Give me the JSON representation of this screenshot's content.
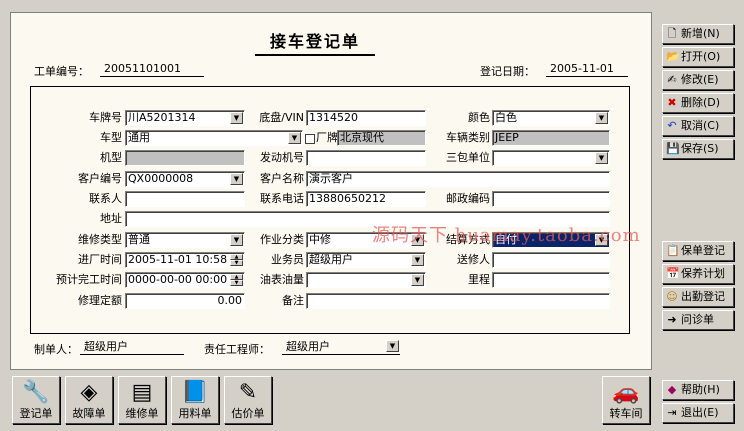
{
  "title": "接车登记单",
  "header": {
    "work_order_label": "工单编号：",
    "work_order_value": "20051101001",
    "register_date_label": "登记日期：",
    "register_date_value": "2005-11-01"
  },
  "form": {
    "plate_label": "车牌号",
    "plate_value": "川A5201314",
    "vin_label": "底盘/VIN",
    "vin_value": "1314520",
    "color_label": "颜色",
    "color_value": "白色",
    "model_label": "车型",
    "model_value": "通用",
    "factory_label": "厂牌",
    "factory_value": "北京现代",
    "vehicle_type_label": "车辆类别",
    "vehicle_type_value": "JEEP",
    "engine_model_label": "机型",
    "engine_model_value": "",
    "engine_no_label": "发动机号",
    "engine_no_value": "",
    "warranty_label": "三包单位",
    "warranty_value": "",
    "customer_no_label": "客户编号",
    "customer_no_value": "QX0000008",
    "customer_name_label": "客户名称",
    "customer_name_value": "演示客户",
    "contact_label": "联系人",
    "contact_value": "",
    "phone_label": "联系电话",
    "phone_value": "13880650212",
    "postcode_label": "邮政编码",
    "postcode_value": "",
    "address_label": "地址",
    "address_value": "",
    "repair_type_label": "维修类型",
    "repair_type_value": "普通",
    "work_class_label": "作业分类",
    "work_class_value": "中修",
    "settle_label": "结算方式",
    "settle_value": "自付",
    "enter_time_label": "进厂时间",
    "enter_time_value": "2005-11-01 10:58",
    "salesman_label": "业务员",
    "salesman_value": "超级用户",
    "sender_label": "送修人",
    "sender_value": "",
    "finish_time_label": "预计完工时间",
    "finish_time_value": "0000-00-00 00:00",
    "fuel_label": "油表油量",
    "fuel_value": "",
    "mileage_label": "里程",
    "mileage_value": "",
    "quota_label": "修理定额",
    "quota_value": "0.00",
    "note_label": "备注",
    "note_value": ""
  },
  "footer": {
    "creator_label": "制单人：",
    "creator_value": "超级用户",
    "engineer_label": "责任工程师：",
    "engineer_value": "超级用户"
  },
  "right_buttons": [
    {
      "label": "新增(N)",
      "icon": "new-doc-icon",
      "glyph": "🗋"
    },
    {
      "label": "打开(O)",
      "icon": "open-folder-icon",
      "glyph": "📂"
    },
    {
      "label": "修改(E)",
      "icon": "edit-icon",
      "glyph": "✍"
    },
    {
      "label": "删除(D)",
      "icon": "delete-icon",
      "glyph": "✖"
    },
    {
      "label": "取消(C)",
      "icon": "cancel-icon",
      "glyph": "↶"
    },
    {
      "label": "保存(S)",
      "icon": "save-icon",
      "glyph": "💾"
    }
  ],
  "right_buttons2": [
    {
      "label": "保单登记",
      "icon": "warranty-register-icon",
      "glyph": "📋"
    },
    {
      "label": "保养计划",
      "icon": "maintenance-plan-icon",
      "glyph": "📅"
    },
    {
      "label": "出勤登记",
      "icon": "attendance-icon",
      "glyph": "☺"
    },
    {
      "label": "问诊单",
      "icon": "inquiry-icon",
      "glyph": "➜"
    }
  ],
  "right_buttons3": [
    {
      "label": "帮助(H)",
      "icon": "help-icon",
      "glyph": "◆"
    },
    {
      "label": "退出(E)",
      "icon": "exit-icon",
      "glyph": "⇥"
    }
  ],
  "bottom_buttons": [
    {
      "label": "登记单",
      "icon": "register-form-icon",
      "glyph": "🔧"
    },
    {
      "label": "故障单",
      "icon": "fault-form-icon",
      "glyph": "◈"
    },
    {
      "label": "维修单",
      "icon": "repair-form-icon",
      "glyph": "▤"
    },
    {
      "label": "用料单",
      "icon": "material-form-icon",
      "glyph": "📘"
    },
    {
      "label": "估价单",
      "icon": "estimate-form-icon",
      "glyph": "✎"
    }
  ],
  "transfer_button": {
    "label": "转车间",
    "icon": "transfer-workshop-icon",
    "glyph": "🚗"
  },
  "watermark": "源码天下 huamay.taoba.com"
}
